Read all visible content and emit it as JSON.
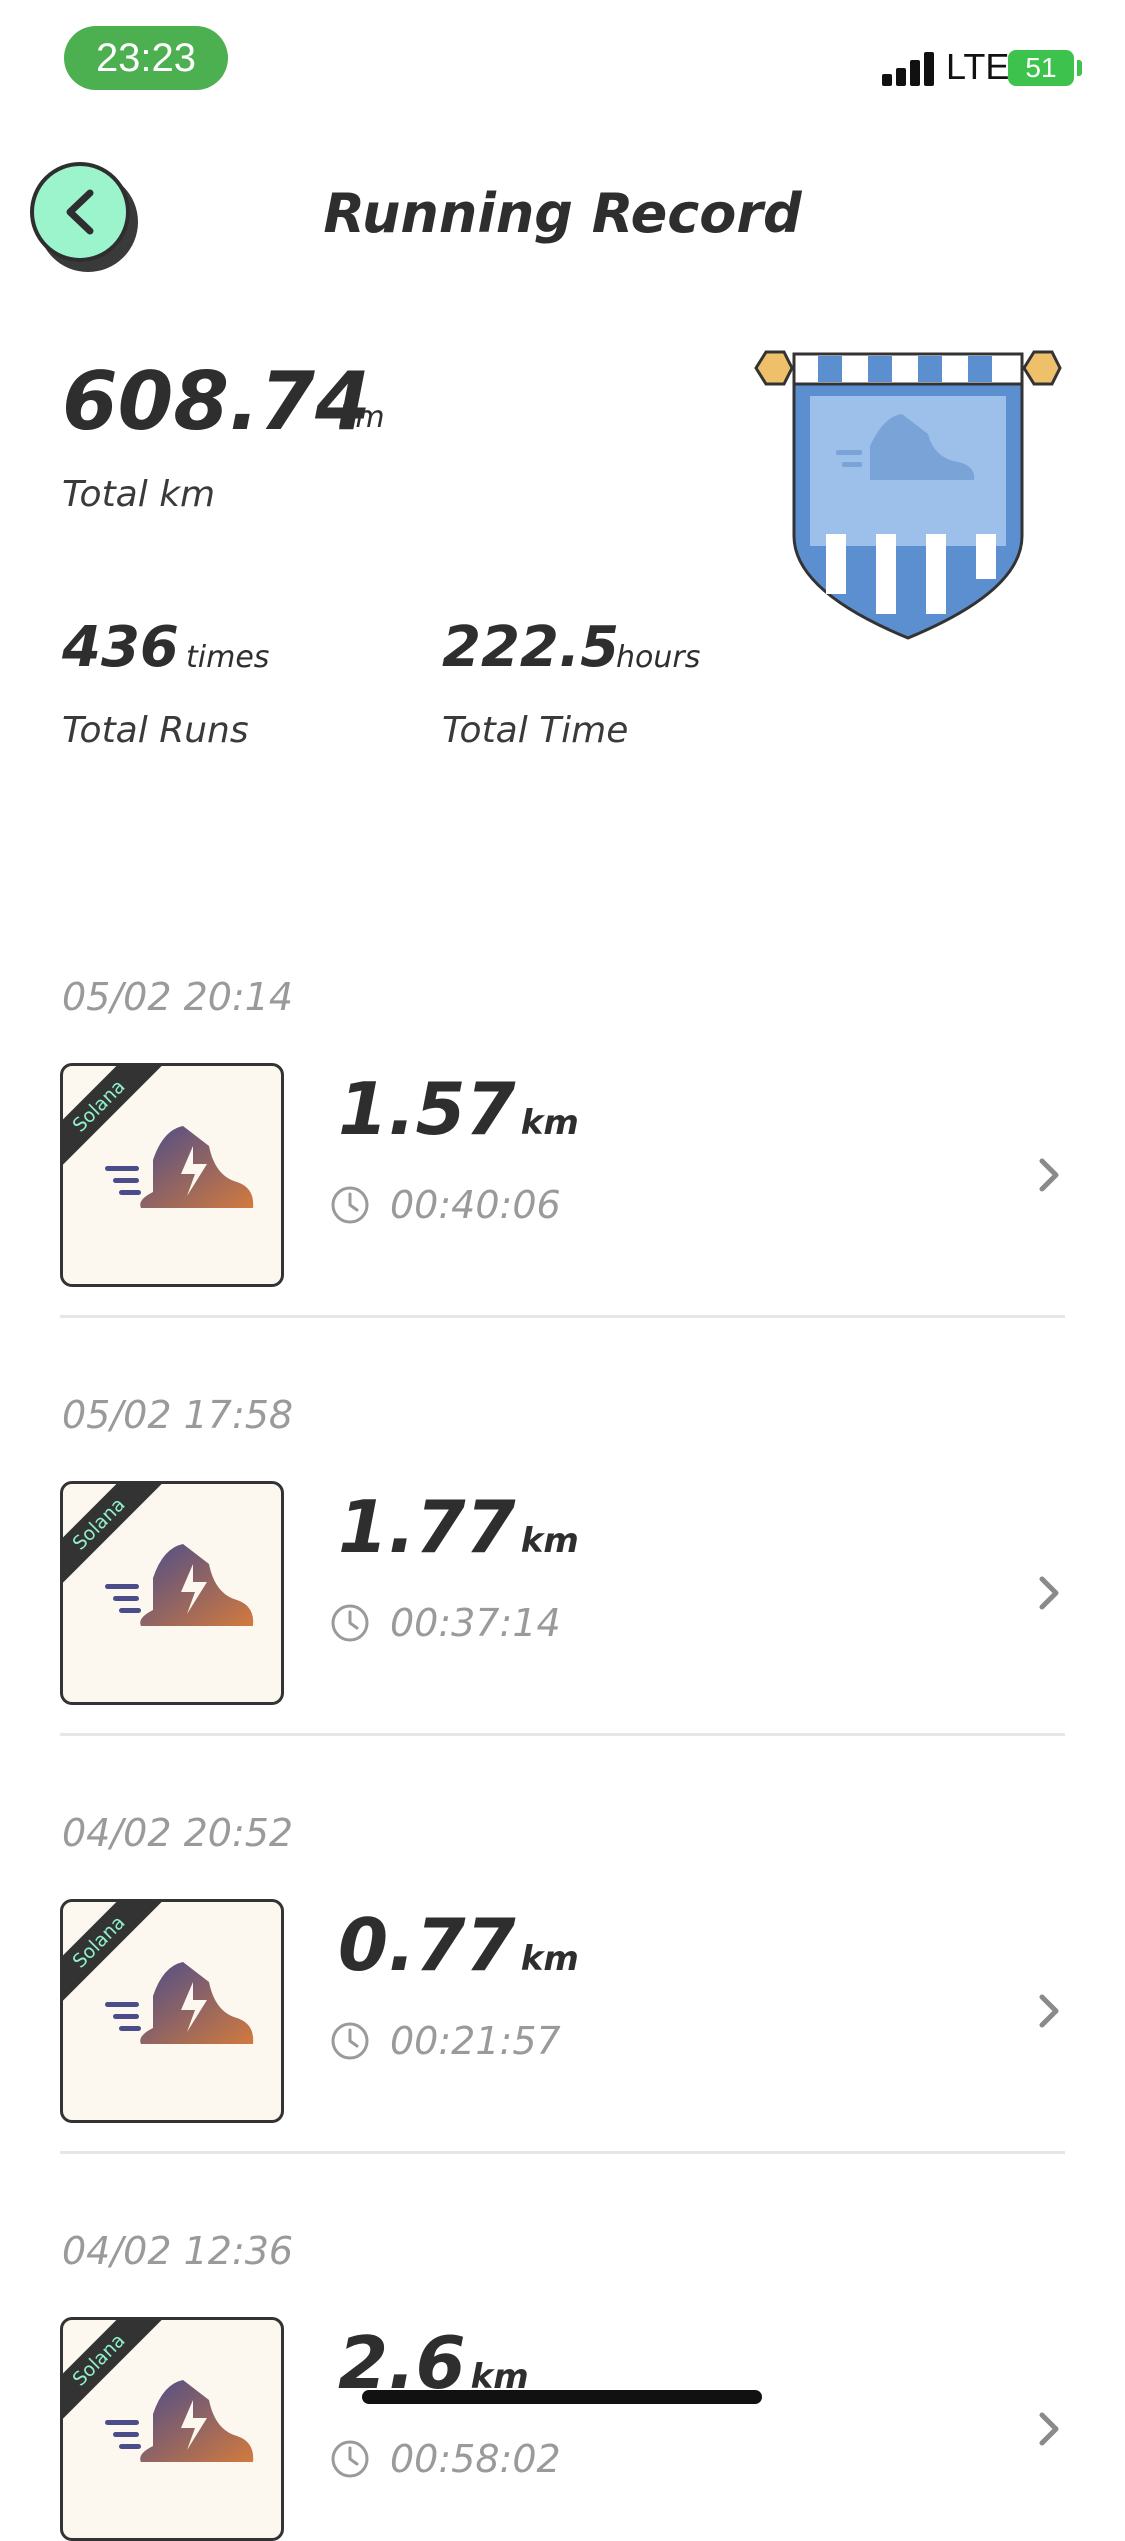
{
  "status_bar": {
    "time": "23:23",
    "network": "LTE",
    "battery": "51"
  },
  "header": {
    "title": "Running Record",
    "back_icon": "chevron-left-icon"
  },
  "summary": {
    "total_km": "608.74",
    "total_km_unit": "km",
    "total_km_label": "Total km",
    "total_runs": "436",
    "total_runs_unit": "times",
    "total_runs_label": "Total Runs",
    "total_time": "222.5",
    "total_time_unit": "hours",
    "total_time_label": "Total Time"
  },
  "runs": [
    {
      "date": "05/02 20:14",
      "badge": "Solana",
      "distance": "1.57",
      "unit": "km",
      "duration": "00:40:06"
    },
    {
      "date": "05/02 17:58",
      "badge": "Solana",
      "distance": "1.77",
      "unit": "km",
      "duration": "00:37:14"
    },
    {
      "date": "04/02 20:52",
      "badge": "Solana",
      "distance": "0.77",
      "unit": "km",
      "duration": "00:21:57"
    },
    {
      "date": "04/02 12:36",
      "badge": "Solana",
      "distance": "2.6",
      "unit": "km",
      "duration": "00:58:02"
    }
  ],
  "colors": {
    "accent_green": "#9cf4cc",
    "time_pill": "#4caf50",
    "battery": "#3cc24d",
    "banner_blue": "#5b8fd0",
    "shoe_gradient_start": "#4b4d8a",
    "shoe_gradient_end": "#d27a3e"
  }
}
